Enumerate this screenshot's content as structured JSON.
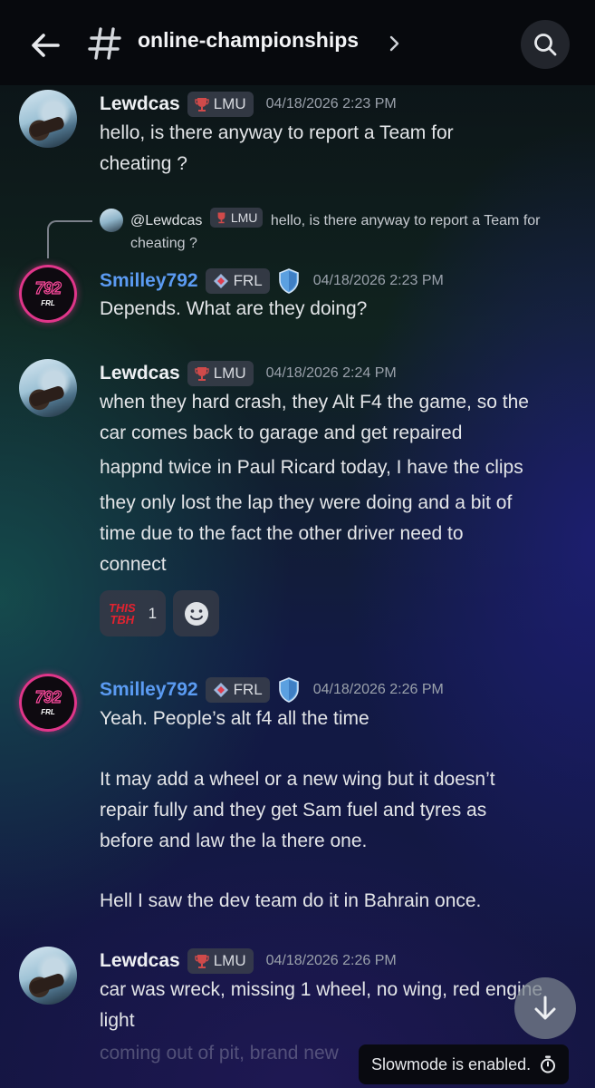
{
  "header": {
    "channel_name": "online-championships"
  },
  "reply_preview": {
    "mention": "@Lewdcas",
    "tag": "LMU",
    "text_line1": "hello, is there anyway to report a Team for",
    "text_line2": "cheating ?"
  },
  "messages": [
    {
      "author": "Lewdcas",
      "tag": "LMU",
      "time": "04/18/2026 2:23 PM",
      "lines": [
        "hello, is there anyway to report a Team for",
        "cheating ?"
      ]
    },
    {
      "author": "Smilley792",
      "tag": "FRL",
      "time": "04/18/2026 2:23 PM",
      "lines": [
        "Depends. What are they doing?"
      ]
    },
    {
      "author": "Lewdcas",
      "tag": "LMU",
      "time": "04/18/2026 2:24 PM",
      "lines": [
        "when they hard crash, they Alt F4 the game, so the",
        "car comes back to garage and get repaired",
        "happnd twice in Paul Ricard today, I have the clips",
        "they only lost the lap they were doing and a bit of",
        "time due to the fact the other driver need to",
        "connect"
      ],
      "reaction": {
        "emoji_line1": "THIS",
        "emoji_line2": "TBH",
        "count": "1"
      }
    },
    {
      "author": "Smilley792",
      "tag": "FRL",
      "time": "04/18/2026 2:26 PM",
      "lines": [
        "Yeah. People’s alt f4 all the time",
        "It may add a wheel or a new wing but it doesn’t",
        "repair fully and they get Sam fuel and tyres as",
        "before and law the la there one.",
        "Hell I saw the dev team do it in Bahrain once."
      ]
    },
    {
      "author": "Lewdcas",
      "tag": "LMU",
      "time": "04/18/2026 2:26 PM",
      "lines": [
        "car was wreck, missing 1 wheel, no wing, red engine",
        "light",
        "coming out of pit, brand new"
      ]
    }
  ],
  "avatar_smi": {
    "number": "792",
    "sub": "FRL"
  },
  "slowmode_text": "Slowmode is enabled.",
  "colors": {
    "smilley_name": "#5b9bf2",
    "lmu_trophy": "#d04a4a",
    "frl_icon": "#e03e4e",
    "shield": "#5ba0e0",
    "reaction_red": "#e4222f"
  },
  "icons": [
    "back-arrow-icon",
    "hash-icon",
    "chevron-right-icon",
    "search-icon",
    "trophy-icon",
    "frl-icon",
    "shield-icon",
    "add-reaction-icon",
    "arrow-down-icon",
    "timer-icon"
  ]
}
